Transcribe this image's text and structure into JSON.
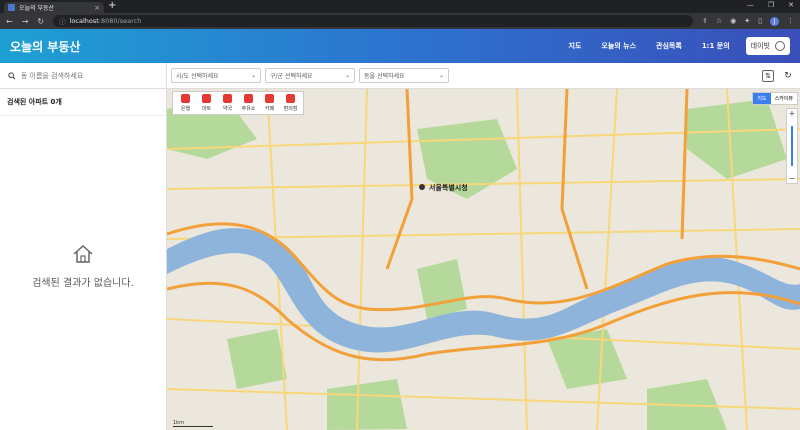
{
  "browser": {
    "tab_title": "오늘의 부동산",
    "url_host": "localhost",
    "url_path": ":8080/search",
    "profile_initial": "J"
  },
  "header": {
    "logo": "오늘의 부동산",
    "nav": [
      "지도",
      "오늘의 뉴스",
      "관심목록",
      "1:1 문의"
    ],
    "user_label": "데이빗"
  },
  "toolbar": {
    "search_placeholder": "동 이름을 검색하세요",
    "selects": [
      "시/도 선택하세요",
      "구/군 선택하세요",
      "동을 선택하세요"
    ]
  },
  "sidebar": {
    "count_label": "검색된 아파트 0개",
    "empty_message": "검색된 결과가 없습니다."
  },
  "map": {
    "categories": [
      "은행",
      "마트",
      "약국",
      "주유소",
      "카페",
      "편의점"
    ],
    "map_types": [
      "지도",
      "스카이뷰"
    ],
    "city_label": "서울특별시청",
    "scale_label": "1km",
    "colors": {
      "river": "#8fb4dc",
      "park": "#b5d99a",
      "road_major": "#f2a13a",
      "road_minor": "#f7d77a",
      "land": "#ece7dc"
    }
  }
}
